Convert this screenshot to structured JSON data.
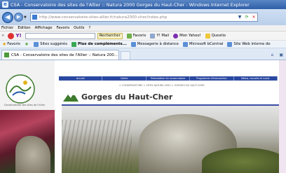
{
  "window": {
    "title": "CSA - Conservatoire des sites de l'Allier :: Natura 2000 Gorges du Haut-Cher - Windows Internet Explorer"
  },
  "address": {
    "url_host": "http://www.conservatoire-sites-allier.fr",
    "url_path": "/natura2000-cher/index.php"
  },
  "menu": {
    "items": [
      "Fichier",
      "Edition",
      "Affichage",
      "Favoris",
      "Outils",
      "?"
    ]
  },
  "toolbar": {
    "logo": "Y!",
    "search_label": "Rechercher",
    "favoris_label": "Favoris",
    "mail_label": "Y! Mail",
    "myyahoo_label": "Mon Yahoo!",
    "questions_label": "Questio"
  },
  "favorites": {
    "favoris_label": "Favoris",
    "items": [
      "Sites suggérés",
      "Plus de compléments...",
      "Messagerie à distance",
      "Microsoft bCentral",
      "Site Web interne de"
    ]
  },
  "tab": {
    "label": "CSA - Conservatoire des sites de l'Allier :: Natura 200..."
  },
  "page": {
    "logo_caption": "Conservatoire des sites de l'Allier",
    "nav_items": [
      "Accueil",
      "Cahier",
      "Présentation du conservatoire",
      "Programme d'intervention",
      "Bilans, conseils et suivis"
    ],
    "breadcrumb": "> CONSERVATOIRE > SITES NATURA 2000 > GORGES DU HAUT-CHER",
    "site_title": "Gorges du Haut-Cher"
  },
  "colors": {
    "title_bar": "#2e5ea8",
    "nav_blue": "#2b49a1",
    "page_accent": "#3a4da3"
  }
}
